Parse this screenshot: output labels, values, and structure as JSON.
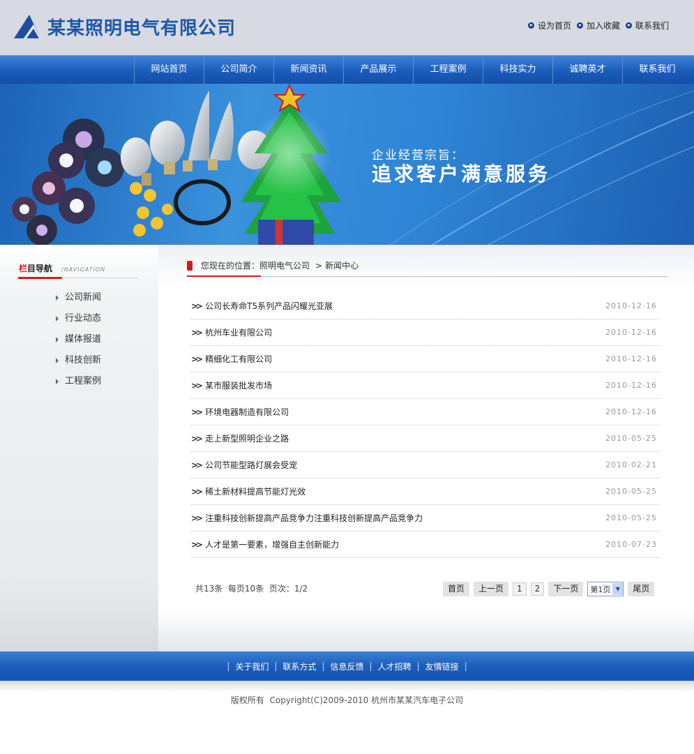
{
  "brand": {
    "name": "某某照明电气有限公司"
  },
  "top_links": [
    "设为首页",
    "加入收藏",
    "联系我们"
  ],
  "nav": [
    "网站首页",
    "公司简介",
    "新闻资讯",
    "产品展示",
    "工程案例",
    "科技实力",
    "诚聘英才",
    "联系我们"
  ],
  "banner": {
    "slogan_line1": "企业经营宗旨：",
    "slogan_line2": "追求客户满意服务"
  },
  "sidebar": {
    "title_red": "栏",
    "title_rest": "目导航",
    "title_en": "/NAVIGATION",
    "items": [
      "公司新闻",
      "行业动态",
      "媒体报道",
      "科技创新",
      "工程案例"
    ]
  },
  "breadcrumb": {
    "label": "您现在的位置：",
    "home": "照明电气公司",
    "separator": ">",
    "current": "新闻中心"
  },
  "news": [
    {
      "title": "公司长寿命T5系列产品闪耀光亚展",
      "date": "2010-12-16"
    },
    {
      "title": "杭州车业有限公司",
      "date": "2010-12-16"
    },
    {
      "title": "精细化工有限公司",
      "date": "2010-12-16"
    },
    {
      "title": "某市服装批发市场",
      "date": "2010-12-16"
    },
    {
      "title": "环境电器制造有限公司",
      "date": "2010-12-16"
    },
    {
      "title": "走上新型照明企业之路",
      "date": "2010-05-25"
    },
    {
      "title": "公司节能型路灯展会受宠",
      "date": "2010-02-21"
    },
    {
      "title": "稀土新材料提高节能灯光效",
      "date": "2010-05-25"
    },
    {
      "title": "注重科技创新提高产品竞争力注重科技创新提高产品竞争力",
      "date": "2010-05-25"
    },
    {
      "title": "人才是第一要素，增强自主创新能力",
      "date": "2010-07-23"
    }
  ],
  "pagination": {
    "total": "共13条",
    "per_page": "每页10条",
    "page_info": "页次：1/2",
    "first": "首页",
    "prev": "上一页",
    "pages": [
      "1",
      "2"
    ],
    "next": "下一页",
    "select_value": "第1页",
    "last": "尾页"
  },
  "footer": {
    "links": [
      "关于我们",
      "联系方式",
      "信息反馈",
      "人才招聘",
      "友情链接"
    ],
    "copyright": "版权所有  Copyright(C)2009-2010 杭州市某某汽车电子公司"
  },
  "colors": {
    "brand_blue": "#1d58a8",
    "nav_blue": "#1a5cba",
    "accent_red": "#d41a1a"
  }
}
